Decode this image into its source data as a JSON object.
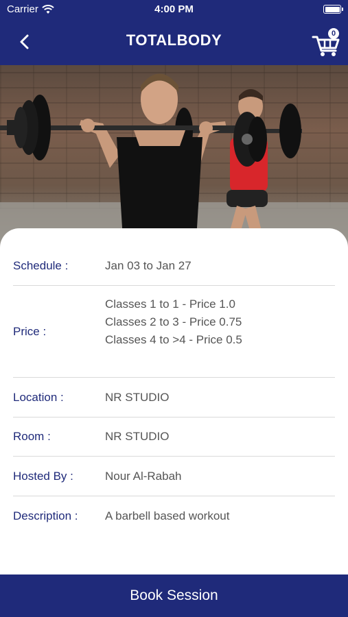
{
  "status_bar": {
    "carrier": "Carrier",
    "time": "4:00 PM"
  },
  "header": {
    "title": "TOTALBODY",
    "cart_count": "0"
  },
  "hero_image": {
    "alt": "Two women performing barbell squats"
  },
  "details": [
    {
      "label": "Schedule :",
      "value": "Jan 03 to Jan 27"
    },
    {
      "label": "Price :",
      "lines": [
        "Classes 1 to 1 - Price 1.0",
        "Classes 2 to 3 - Price 0.75",
        "Classes 4 to >4 - Price 0.5"
      ]
    },
    {
      "label": "Location :",
      "value": "NR STUDIO"
    },
    {
      "label": "Room :",
      "value": "NR STUDIO"
    },
    {
      "label": "Hosted By :",
      "value": "Nour Al-Rabah"
    },
    {
      "label": "Description :",
      "value": "A barbell based workout"
    }
  ],
  "footer": {
    "book_label": "Book Session"
  },
  "colors": {
    "primary": "#1f2a7a",
    "label": "#1f2a7a",
    "value": "#555555"
  }
}
